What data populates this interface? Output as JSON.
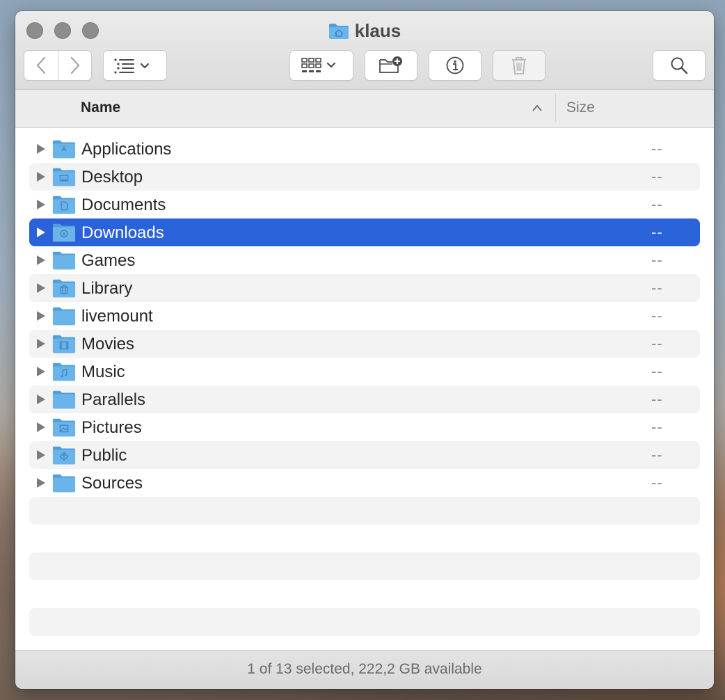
{
  "window": {
    "title": "klaus"
  },
  "toolbar": {
    "back": "back",
    "forward": "forward",
    "view_options": "list",
    "group": "group",
    "new_folder": "new folder",
    "info": "info",
    "trash": "trash",
    "search": "search"
  },
  "columns": {
    "name": "Name",
    "size": "Size"
  },
  "rows": [
    {
      "name": "Applications",
      "size": "--",
      "icon": "applications-folder-icon"
    },
    {
      "name": "Desktop",
      "size": "--",
      "icon": "desktop-folder-icon"
    },
    {
      "name": "Documents",
      "size": "--",
      "icon": "documents-folder-icon"
    },
    {
      "name": "Downloads",
      "size": "--",
      "icon": "downloads-folder-icon",
      "selected": true
    },
    {
      "name": "Games",
      "size": "--",
      "icon": "folder-icon"
    },
    {
      "name": "Library",
      "size": "--",
      "icon": "library-folder-icon"
    },
    {
      "name": "livemount",
      "size": "--",
      "icon": "folder-icon"
    },
    {
      "name": "Movies",
      "size": "--",
      "icon": "movies-folder-icon"
    },
    {
      "name": "Music",
      "size": "--",
      "icon": "music-folder-icon"
    },
    {
      "name": "Parallels",
      "size": "--",
      "icon": "folder-icon"
    },
    {
      "name": "Pictures",
      "size": "--",
      "icon": "pictures-folder-icon"
    },
    {
      "name": "Public",
      "size": "--",
      "icon": "public-folder-icon"
    },
    {
      "name": "Sources",
      "size": "--",
      "icon": "folder-icon"
    }
  ],
  "status": {
    "text": "1 of 13 selected, 222,2 GB available"
  },
  "colors": {
    "selection": "#2962d9",
    "folder": "#6bb4ea",
    "folder_tab": "#4f9fdc"
  }
}
